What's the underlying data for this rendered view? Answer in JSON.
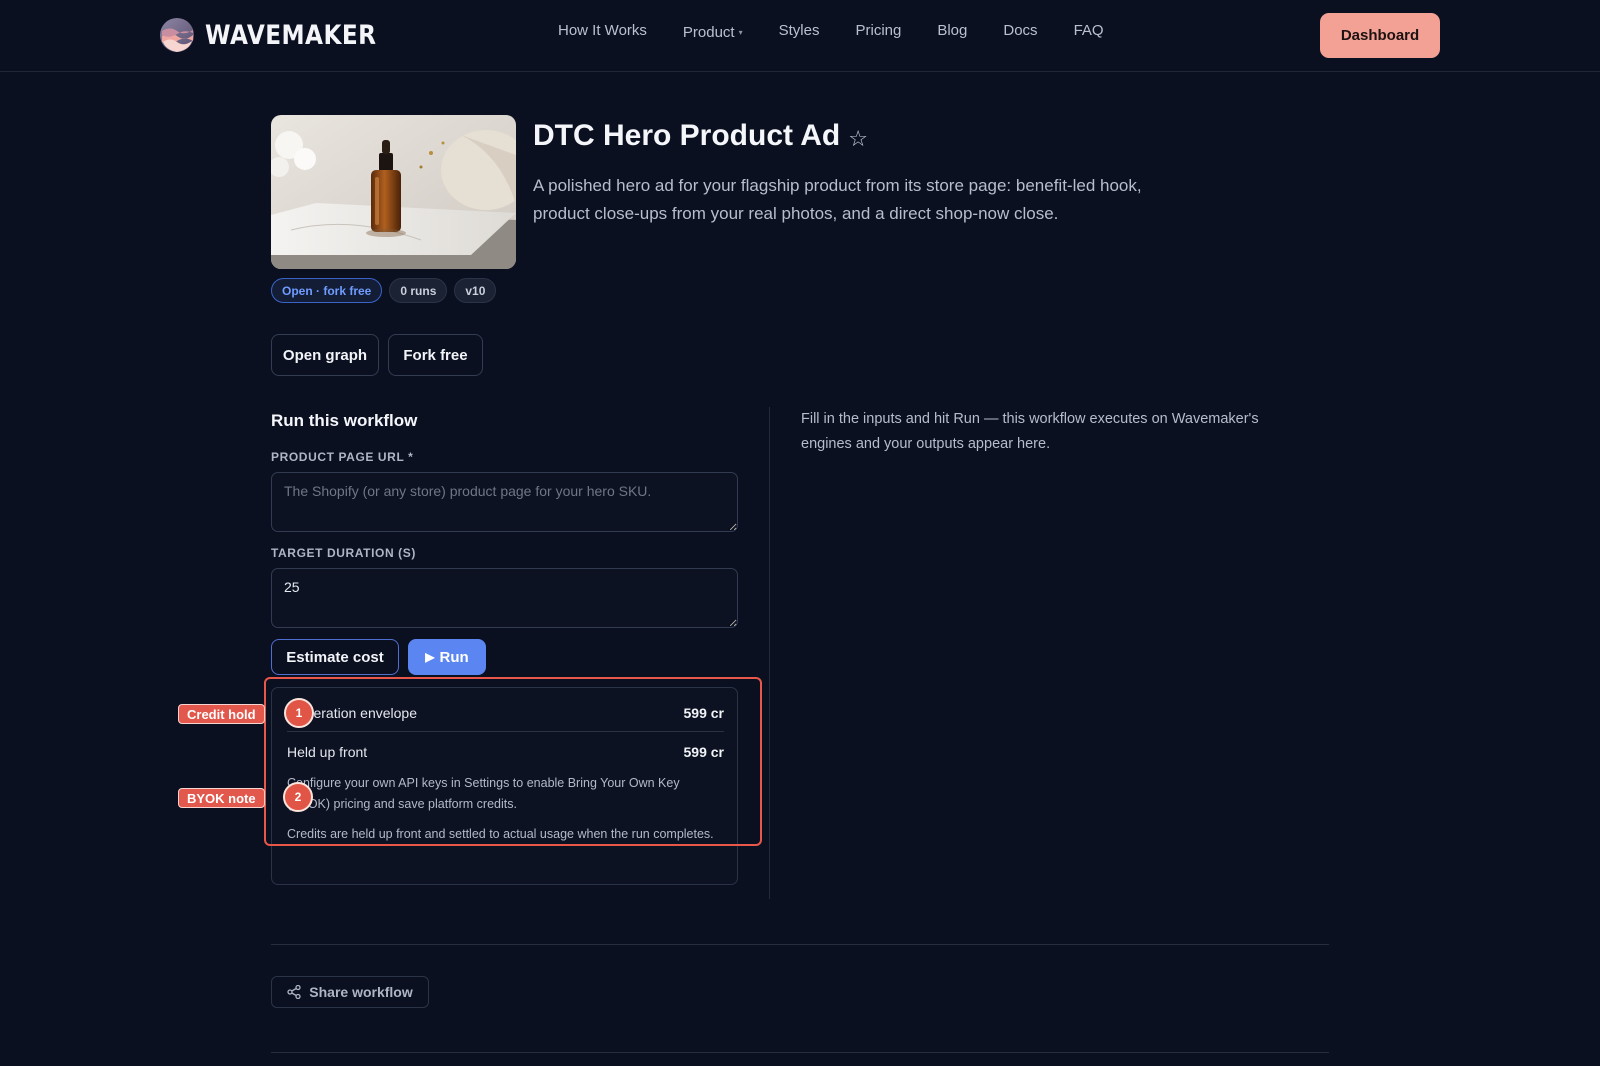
{
  "nav": {
    "brand": "WAVEMAKER",
    "links": [
      "How It Works",
      "Product",
      "Styles",
      "Pricing",
      "Blog",
      "Docs",
      "FAQ"
    ],
    "dashboard_label": "Dashboard"
  },
  "workflow": {
    "title": "DTC Hero Product Ad",
    "description": "A polished hero ad for your flagship product from its store page: benefit-led hook, product close-ups from your real photos, and a direct shop-now close.",
    "badges": [
      "Open · fork free",
      "0 runs",
      "v10"
    ],
    "open_graph_label": "Open graph",
    "fork_label": "Fork free"
  },
  "run_form": {
    "title": "Run this workflow",
    "url_label": "PRODUCT PAGE URL *",
    "url_placeholder": "The Shopify (or any store) product page for your hero SKU.",
    "url_value": "",
    "duration_label": "TARGET DURATION (S)",
    "duration_value": "25",
    "estimate_label": "Estimate cost",
    "run_label": "Run"
  },
  "cost": {
    "envelope_label": "Generation envelope",
    "envelope_value": "599 cr",
    "held_label": "Held up front",
    "held_value": "599 cr",
    "byok_note": "Configure your own API keys in Settings to enable Bring Your Own Key (BYOK) pricing and save platform credits.",
    "settle_note": "Credits are held up front and settled to actual usage when the run completes."
  },
  "annotations": [
    {
      "label": "Credit hold",
      "number": "1"
    },
    {
      "label": "BYOK note",
      "number": "2"
    }
  ],
  "output": {
    "hint": "Fill in the inputs and hit Run — this workflow executes on Wavemaker's engines and your outputs appear here."
  },
  "share_label": "Share workflow",
  "colors": {
    "background": "#0b1020",
    "accent_blue": "#5b86f2",
    "dashboard_salmon": "#f4a195",
    "annotation_red": "#e8574a"
  }
}
